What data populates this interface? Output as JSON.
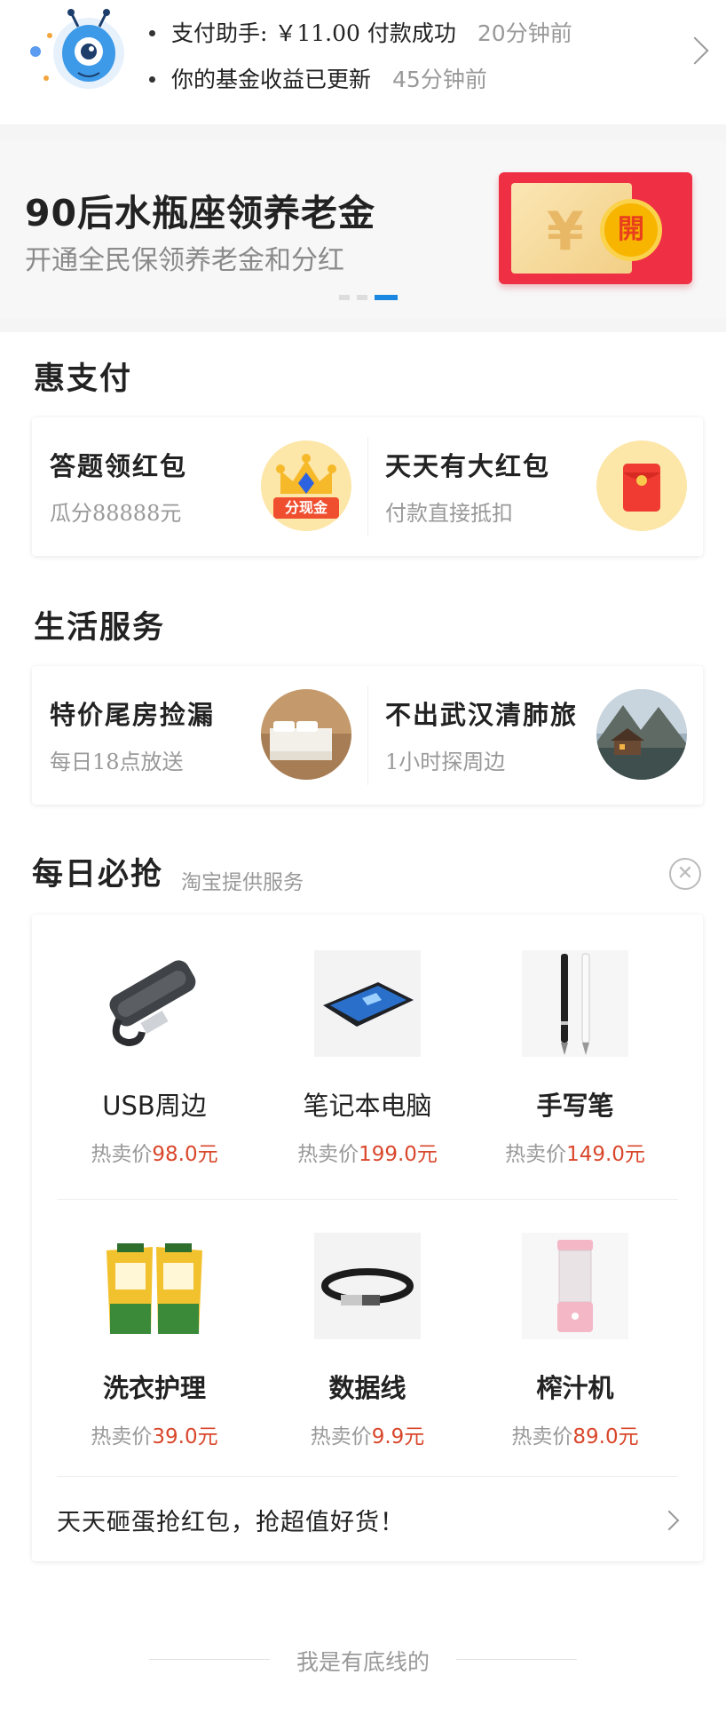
{
  "notifications": [
    {
      "text": "支付助手: ￥11.00 付款成功",
      "time": "20分钟前"
    },
    {
      "text": "你的基金收益已更新",
      "time": "45分钟前"
    }
  ],
  "banner": {
    "title": "90后水瓶座领养老金",
    "subtitle": "开通全民保领养老金和分红",
    "coin_label": "開",
    "yen": "¥"
  },
  "hui_pay": {
    "title": "惠支付",
    "items": [
      {
        "title": "答题领红包",
        "subtitle": "瓜分88888元",
        "badge": "分现金"
      },
      {
        "title": "天天有大红包",
        "subtitle": "付款直接抵扣"
      }
    ]
  },
  "life_services": {
    "title": "生活服务",
    "items": [
      {
        "title": "特价尾房捡漏",
        "subtitle": "每日18点放送"
      },
      {
        "title": "不出武汉清肺旅",
        "subtitle": "1小时探周边"
      }
    ]
  },
  "daily_deals": {
    "title": "每日必抢",
    "provider": "淘宝提供服务",
    "price_prefix": "热卖价",
    "products": [
      {
        "name": "USB周边",
        "price": "98.0元"
      },
      {
        "name": "笔记本电脑",
        "price": "199.0元"
      },
      {
        "name": "手写笔",
        "price": "149.0元"
      },
      {
        "name": "洗衣护理",
        "price": "39.0元"
      },
      {
        "name": "数据线",
        "price": "9.9元"
      },
      {
        "name": "榨汁机",
        "price": "89.0元"
      }
    ],
    "promo_text": "天天砸蛋抢红包，抢超值好货！"
  },
  "footer": {
    "text": "我是有底线的"
  },
  "colors": {
    "accent_blue": "#1a87e0",
    "price_red": "#d9472b",
    "packet_red": "#ef2f44"
  }
}
